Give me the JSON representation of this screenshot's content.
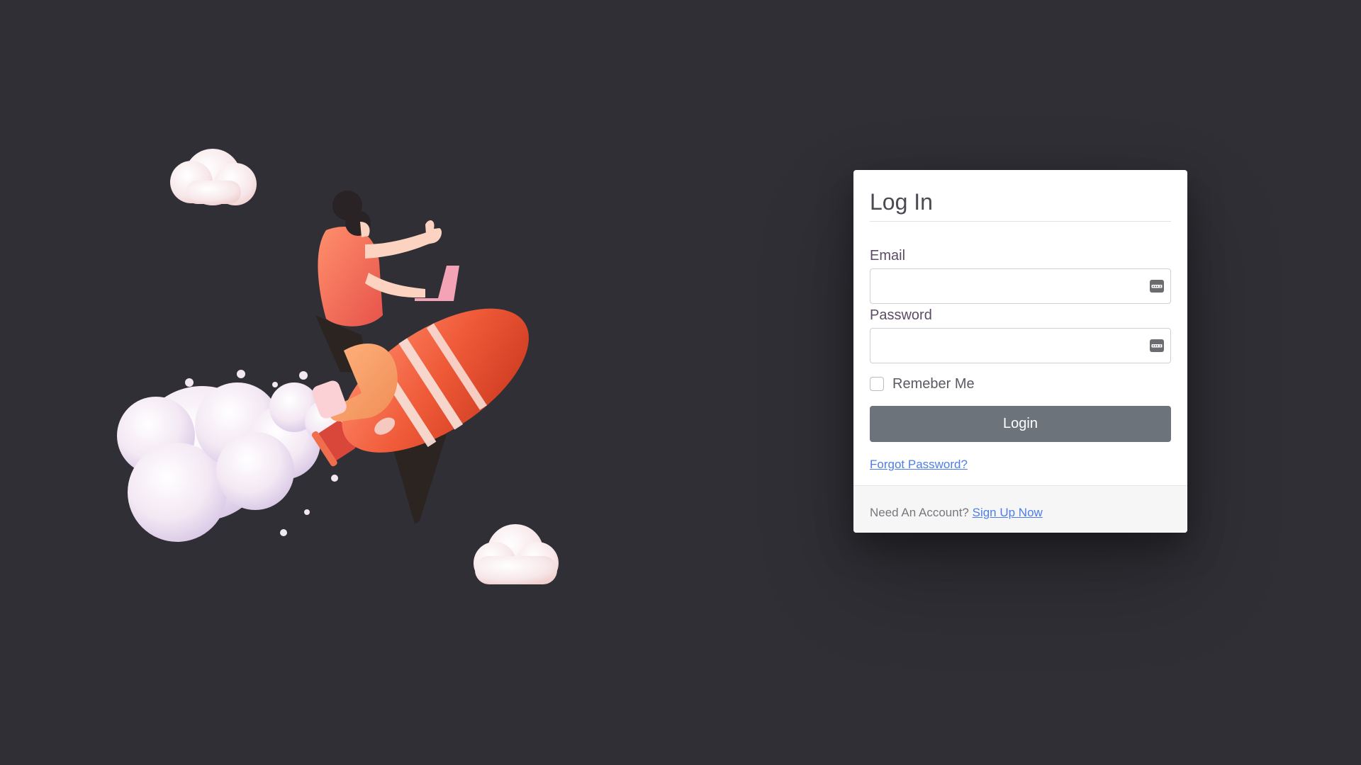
{
  "login": {
    "title": "Log In",
    "email_label": "Email",
    "email_value": "",
    "password_label": "Password",
    "password_value": "",
    "remember_label": "Remeber Me",
    "remember_checked": false,
    "login_button": "Login",
    "forgot_link": "Forgot Password?",
    "footer_text": "Need An Account?",
    "signup_link": "Sign Up Now"
  },
  "icons": {
    "email_field_icon": "password-manager-key-icon",
    "password_field_icon": "password-manager-key-icon",
    "hero": "rocket-rider-illustration"
  },
  "colors": {
    "background": "#302f35",
    "card": "#ffffff",
    "button": "#6c737b",
    "link": "#4d7ee8",
    "rocket": "#ef5a38"
  }
}
